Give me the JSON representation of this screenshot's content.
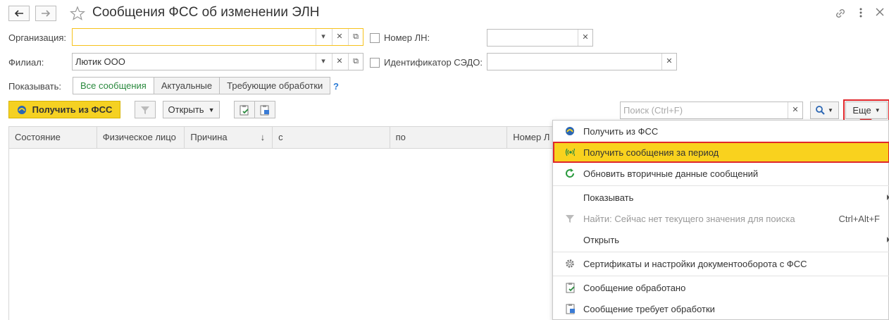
{
  "title": "Сообщения ФСС об изменении ЭЛН",
  "filters": {
    "org_label": "Организация:",
    "org_value": "",
    "branch_label": "Филиал:",
    "branch_value": "Лютик ООО",
    "ln_label": "Номер ЛН:",
    "ln_value": "",
    "sedo_label": "Идентификатор СЭДО:",
    "sedo_value": ""
  },
  "show": {
    "label": "Показывать:",
    "tabs": [
      "Все сообщения",
      "Актуальные",
      "Требующие обработки"
    ],
    "help": "?"
  },
  "toolbar": {
    "get_fss": "Получить из ФСС",
    "open": "Открыть",
    "search_placeholder": "Поиск (Ctrl+F)",
    "more": "Еще"
  },
  "table": {
    "columns": [
      "Состояние",
      "Физическое лицо",
      "Причина",
      "с",
      "по",
      "Номер Л"
    ],
    "sort_indicator": "↓"
  },
  "menu": {
    "items": [
      {
        "label": "Получить из ФСС",
        "icon": "fss-logo-icon"
      },
      {
        "label": "Получить сообщения за период",
        "icon": "broadcast-icon"
      },
      {
        "label": "Обновить вторичные данные сообщений",
        "icon": "refresh-icon"
      },
      {
        "label": "Показывать",
        "icon": ""
      },
      {
        "label": "Найти: Сейчас нет текущего значения для поиска",
        "icon": "filter-icon",
        "shortcut": "Ctrl+Alt+F"
      },
      {
        "label": "Открыть",
        "icon": ""
      },
      {
        "label": "Сертификаты и настройки документооборота с ФСС",
        "icon": "gear-icon"
      },
      {
        "label": "Сообщение обработано",
        "icon": "clipboard-check-icon"
      },
      {
        "label": "Сообщение требует обработки",
        "icon": "clipboard-edit-icon"
      }
    ]
  },
  "colors": {
    "accent_yellow": "#f5d122",
    "highlight_red": "#e0262a",
    "tab_green": "#2a8a3e"
  }
}
